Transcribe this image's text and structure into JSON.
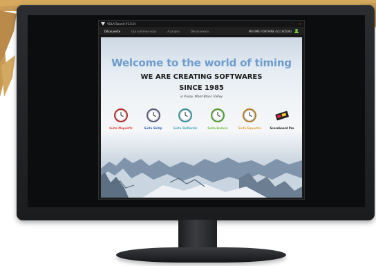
{
  "app": {
    "title": "VOLA Board (V1.0.0)"
  },
  "menu": {
    "items": [
      {
        "label": "Découverte",
        "active": true
      },
      {
        "label": "Qui sommes-nous",
        "active": false
      },
      {
        "label": "A propos",
        "active": false
      },
      {
        "label": "Déconnexion",
        "active": false
      }
    ],
    "user": "MAXIME FONTAINE (V1190508)"
  },
  "hero": {
    "title": "Welcome to the world of timing",
    "line1": "WE ARE CREATING SOFTWARES",
    "line2": "SINCE 1985",
    "location": "in Passy, Mont-Blanc Valley"
  },
  "suites": [
    {
      "label": "Suite Mapsoftc",
      "color": "#e0453b",
      "ring": "#b0302a"
    },
    {
      "label": "Suite SkiVp",
      "color": "#3a64b4",
      "ring": "#5a5a7a"
    },
    {
      "label": "Suite SkiNordic",
      "color": "#40a8b8",
      "ring": "#3b8f99"
    },
    {
      "label": "Suite Enduro",
      "color": "#6abe3d",
      "ring": "#4f9a2d"
    },
    {
      "label": "Suite Equestre",
      "color": "#e0a23a",
      "ring": "#b07a28"
    },
    {
      "label": "Scoreboard Pro",
      "color": "#1a1a1a",
      "ring": "#333333"
    }
  ],
  "colors": {
    "accent_title": "#6e9ccc",
    "user_icon": "#7ac943"
  }
}
